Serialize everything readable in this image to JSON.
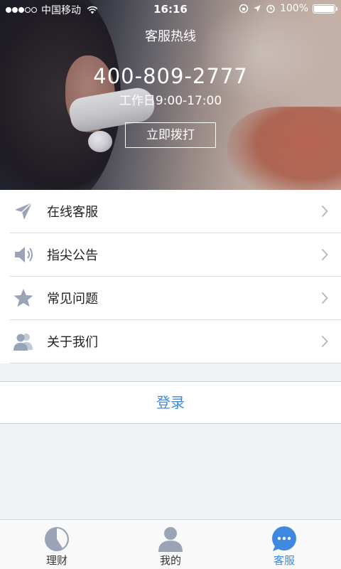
{
  "status_bar": {
    "carrier": "中国移动",
    "time": "16:16",
    "battery": "100%"
  },
  "hero": {
    "title": "客服热线",
    "phone": "400-809-2777",
    "hours": "工作日9:00-17:00",
    "call_button": "立即拨打"
  },
  "menu": {
    "items": [
      {
        "label": "在线客服",
        "icon": "send-icon"
      },
      {
        "label": "指尖公告",
        "icon": "speaker-icon"
      },
      {
        "label": "常见问题",
        "icon": "star-icon"
      },
      {
        "label": "关于我们",
        "icon": "people-icon"
      }
    ]
  },
  "login": {
    "label": "登录"
  },
  "tabbar": {
    "tabs": [
      {
        "label": "理财",
        "icon": "pie-chart-icon",
        "active": false
      },
      {
        "label": "我的",
        "icon": "user-icon",
        "active": false
      },
      {
        "label": "客服",
        "icon": "chat-bubble-icon",
        "active": true
      }
    ]
  },
  "colors": {
    "accent": "#3f88e0",
    "icon_gray": "#9aa4b6",
    "background": "#eff2f5"
  }
}
